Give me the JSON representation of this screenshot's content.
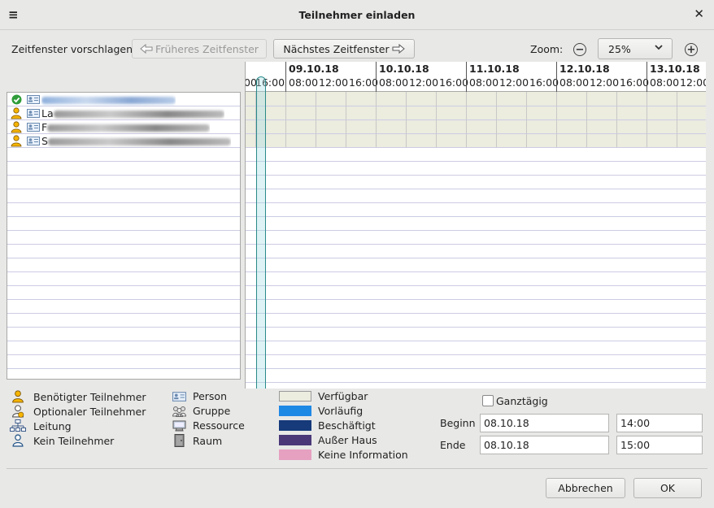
{
  "window": {
    "title": "Teilnehmer einladen",
    "menu_glyph": "≡",
    "close_glyph": "✕"
  },
  "toolbar": {
    "suggest_label": "Zeitfenster vorschlagen:",
    "prev_label": "Früheres Zeitfenster",
    "next_label": "Nächstes Zeitfenster",
    "zoom_label": "Zoom:",
    "zoom_value": "25%"
  },
  "attendees": [
    {
      "role": "organizer",
      "name": ""
    },
    {
      "role": "required",
      "name": "La"
    },
    {
      "role": "required",
      "name": "F"
    },
    {
      "role": "required",
      "name": "S"
    }
  ],
  "timeline": {
    "first_partial": {
      "hours": [
        "00",
        "16:00"
      ]
    },
    "days": [
      {
        "date": "09.10.18",
        "hours": [
          "08:00",
          "12:00",
          "16:00"
        ]
      },
      {
        "date": "10.10.18",
        "hours": [
          "08:00",
          "12:00",
          "16:00"
        ]
      },
      {
        "date": "11.10.18",
        "hours": [
          "08:00",
          "12:00",
          "16:00"
        ]
      },
      {
        "date": "12.10.18",
        "hours": [
          "08:00",
          "12:00",
          "16:00"
        ]
      },
      {
        "date": "13.10.18",
        "hours": [
          "08:00",
          "12:00"
        ]
      }
    ]
  },
  "legend": {
    "roles": [
      {
        "icon": "required-attendee-icon",
        "label": "Benötigter Teilnehmer"
      },
      {
        "icon": "optional-attendee-icon",
        "label": "Optionaler Teilnehmer"
      },
      {
        "icon": "chair-icon",
        "label": "Leitung"
      },
      {
        "icon": "non-participant-icon",
        "label": "Kein Teilnehmer"
      }
    ],
    "types": [
      {
        "icon": "person-card-icon",
        "label": "Person"
      },
      {
        "icon": "group-icon",
        "label": "Gruppe"
      },
      {
        "icon": "resource-icon",
        "label": "Ressource"
      },
      {
        "icon": "room-icon",
        "label": "Raum"
      }
    ],
    "states": [
      {
        "color": "#ececdf",
        "label": "Verfügbar"
      },
      {
        "color": "#1e88e5",
        "label": "Vorläufig"
      },
      {
        "color": "#163a7a",
        "label": "Beschäftigt"
      },
      {
        "color": "#4a3878",
        "label": "Außer Haus"
      },
      {
        "color": "#e6a0c0",
        "label": "Keine Information"
      }
    ]
  },
  "datetime": {
    "allday_label": "Ganztägig",
    "start_label": "Beginn",
    "start_date": "08.10.18",
    "start_time": "14:00",
    "end_label": "Ende",
    "end_date": "08.10.18",
    "end_time": "15:00"
  },
  "footer": {
    "cancel_label": "Abbrechen",
    "ok_label": "OK"
  }
}
